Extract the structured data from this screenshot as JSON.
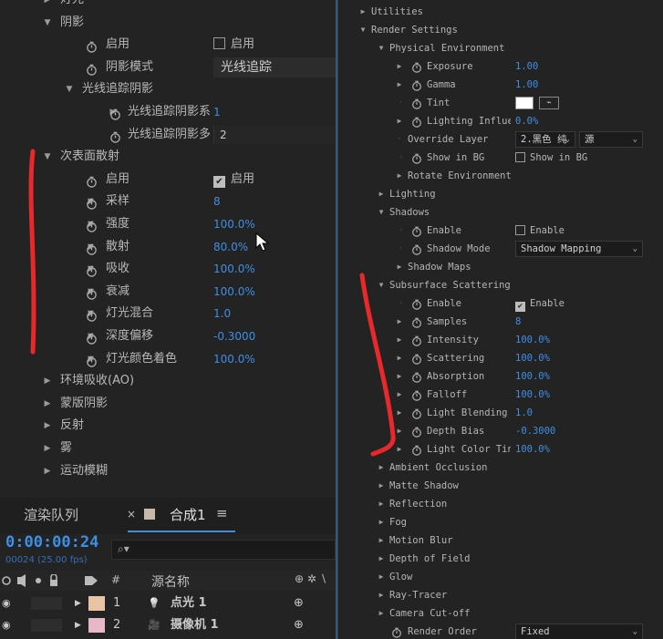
{
  "left_panel": {
    "rows": [
      {
        "id": "light",
        "label": "灯光",
        "arrow": "▶",
        "indent": 0
      },
      {
        "id": "shadow",
        "label": "阴影",
        "arrow": "▼",
        "indent": 0
      },
      {
        "id": "shadow-enable",
        "label": "启用",
        "indent": 2,
        "stopwatch": true,
        "checkbox": {
          "checked": false,
          "label": "启用"
        }
      },
      {
        "id": "shadow-mode",
        "label": "阴影模式",
        "indent": 2,
        "stopwatch": true,
        "dropdown": "光线追踪"
      },
      {
        "id": "rt-shadow",
        "label": "光线追踪阴影",
        "arrow": "▼",
        "indent": 1
      },
      {
        "id": "rt-shadow-1",
        "label": "光线追踪阴影系",
        "arrow": "▶",
        "indent": 3,
        "stopwatch": true,
        "value": "1"
      },
      {
        "id": "rt-shadow-2",
        "label": "光线追踪阴影多",
        "indent": 3,
        "stopwatch": true,
        "field": "2"
      },
      {
        "id": "sss",
        "label": "次表面散射",
        "arrow": "▼",
        "indent": 0
      },
      {
        "id": "sss-enable",
        "label": "启用",
        "indent": 2,
        "stopwatch": true,
        "checkbox": {
          "checked": true,
          "label": "启用"
        }
      },
      {
        "id": "sss-samples",
        "label": "采样",
        "arrow": "▶",
        "indent": 2,
        "stopwatch": true,
        "value": "8"
      },
      {
        "id": "sss-intensity",
        "label": "强度",
        "arrow": "▶",
        "indent": 2,
        "stopwatch": true,
        "value": "100.0%"
      },
      {
        "id": "sss-scatter",
        "label": "散射",
        "arrow": "▶",
        "indent": 2,
        "stopwatch": true,
        "value": "80.0%"
      },
      {
        "id": "sss-absorb",
        "label": "吸收",
        "arrow": "▶",
        "indent": 2,
        "stopwatch": true,
        "value": "100.0%"
      },
      {
        "id": "sss-falloff",
        "label": "衰减",
        "arrow": "▶",
        "indent": 2,
        "stopwatch": true,
        "value": "100.0%"
      },
      {
        "id": "sss-lightblend",
        "label": "灯光混合",
        "arrow": "▶",
        "indent": 2,
        "stopwatch": true,
        "value": "1.0"
      },
      {
        "id": "sss-depthbias",
        "label": "深度偏移",
        "arrow": "▶",
        "indent": 2,
        "stopwatch": true,
        "value": "-0.3000"
      },
      {
        "id": "sss-lighttint",
        "label": "灯光颜色着色",
        "arrow": "▶",
        "indent": 2,
        "stopwatch": true,
        "value": "100.0%"
      },
      {
        "id": "ao",
        "label": "环境吸收(AO)",
        "arrow": "▶",
        "indent": 0
      },
      {
        "id": "matte",
        "label": "蒙版阴影",
        "arrow": "▶",
        "indent": 0
      },
      {
        "id": "reflect",
        "label": "反射",
        "arrow": "▶",
        "indent": 0
      },
      {
        "id": "fog",
        "label": "雾",
        "arrow": "▶",
        "indent": 0
      },
      {
        "id": "motionblur",
        "label": "运动模糊",
        "arrow": "▶",
        "indent": 0
      }
    ]
  },
  "timeline": {
    "tab_render_queue": "渲染队列",
    "tab_close": "×",
    "tab_comp": "合成1",
    "tab_menu": "≡",
    "timecode": "0:00:00:24",
    "frames": "00024 (25.00 fps)",
    "search_icon": "⌕▾",
    "header_hash": "#",
    "header_source": "源名称",
    "layers": [
      {
        "num": "1",
        "color": "#e8c4a4",
        "icon": "💡",
        "name": "点光 1"
      },
      {
        "num": "2",
        "color": "#e8b8c8",
        "icon": "🎥",
        "name": "摄像机 1"
      }
    ]
  },
  "right_panel": {
    "rows": [
      {
        "id": "utilities",
        "label": "Utilities",
        "arrow": "▶",
        "indent": 0
      },
      {
        "id": "render-settings",
        "label": "Render Settings",
        "arrow": "▼",
        "indent": 0
      },
      {
        "id": "phys-env",
        "label": "Physical Environment",
        "arrow": "▼",
        "indent": 1
      },
      {
        "id": "exposure",
        "label": "Exposure",
        "arrow": "▶",
        "indent": 3,
        "stopwatch": true,
        "value": "1.00"
      },
      {
        "id": "gamma",
        "label": "Gamma",
        "arrow": "▶",
        "indent": 3,
        "stopwatch": true,
        "value": "1.00"
      },
      {
        "id": "tint",
        "label": "Tint",
        "indent": 3,
        "stopwatch": true,
        "swatch": "#ffffff"
      },
      {
        "id": "lighting-influence",
        "label": "Lighting Influer",
        "arrow": "▶",
        "indent": 3,
        "stopwatch": true,
        "value": "0.0%"
      },
      {
        "id": "override-layer",
        "label": "Override Layer",
        "indent": 2,
        "dot": true,
        "dropdown1": "2.黑色 纯",
        "dropdown2": "源"
      },
      {
        "id": "show-in-bg",
        "label": "Show in BG",
        "indent": 3,
        "stopwatch": true,
        "checkbox": {
          "checked": false,
          "label": "Show in BG"
        }
      },
      {
        "id": "rotate-env",
        "label": "Rotate Environment",
        "arrow": "▶",
        "indent": 2
      },
      {
        "id": "lighting",
        "label": "Lighting",
        "arrow": "▶",
        "indent": 1
      },
      {
        "id": "shadows",
        "label": "Shadows",
        "arrow": "▼",
        "indent": 1
      },
      {
        "id": "sh-enable",
        "label": "Enable",
        "indent": 3,
        "stopwatch": true,
        "checkbox": {
          "checked": false,
          "label": "Enable"
        }
      },
      {
        "id": "sh-mode",
        "label": "Shadow Mode",
        "indent": 3,
        "stopwatch": true,
        "dropdown": "Shadow Mapping"
      },
      {
        "id": "sh-maps",
        "label": "Shadow Maps",
        "arrow": "▶",
        "indent": 2
      },
      {
        "id": "subsurface",
        "label": "Subsurface Scattering",
        "arrow": "▼",
        "indent": 1
      },
      {
        "id": "ss-enable",
        "label": "Enable",
        "indent": 3,
        "stopwatch": true,
        "checkbox": {
          "checked": true,
          "label": "Enable"
        }
      },
      {
        "id": "ss-samples",
        "label": "Samples",
        "arrow": "▶",
        "indent": 3,
        "stopwatch": true,
        "value": "8"
      },
      {
        "id": "ss-intensity",
        "label": "Intensity",
        "arrow": "▶",
        "indent": 3,
        "stopwatch": true,
        "value": "100.0%"
      },
      {
        "id": "ss-scattering",
        "label": "Scattering",
        "arrow": "▶",
        "indent": 3,
        "stopwatch": true,
        "value": "100.0%"
      },
      {
        "id": "ss-absorption",
        "label": "Absorption",
        "arrow": "▶",
        "indent": 3,
        "stopwatch": true,
        "value": "100.0%"
      },
      {
        "id": "ss-falloff",
        "label": "Falloff",
        "arrow": "▶",
        "indent": 3,
        "stopwatch": true,
        "value": "100.0%"
      },
      {
        "id": "ss-lightblend",
        "label": "Light Blending",
        "arrow": "▶",
        "indent": 3,
        "stopwatch": true,
        "value": "1.0"
      },
      {
        "id": "ss-depthbias",
        "label": "Depth Bias",
        "arrow": "▶",
        "indent": 3,
        "stopwatch": true,
        "value": "-0.3000"
      },
      {
        "id": "ss-lighttint",
        "label": "Light Color Tin",
        "arrow": "▶",
        "indent": 3,
        "stopwatch": true,
        "value": "100.0%"
      },
      {
        "id": "ambient-occ",
        "label": "Ambient Occlusion",
        "arrow": "▶",
        "indent": 1
      },
      {
        "id": "matte-shadow",
        "label": "Matte Shadow",
        "arrow": "▶",
        "indent": 1
      },
      {
        "id": "reflection",
        "label": "Reflection",
        "arrow": "▶",
        "indent": 1
      },
      {
        "id": "fog",
        "label": "Fog",
        "arrow": "▶",
        "indent": 1
      },
      {
        "id": "motion-blur",
        "label": "Motion Blur",
        "arrow": "▶",
        "indent": 1
      },
      {
        "id": "dof",
        "label": "Depth of Field",
        "arrow": "▶",
        "indent": 1
      },
      {
        "id": "glow",
        "label": "Glow",
        "arrow": "▶",
        "indent": 1
      },
      {
        "id": "ray-tracer",
        "label": "Ray-Tracer",
        "arrow": "▶",
        "indent": 1
      },
      {
        "id": "camera-cutoff",
        "label": "Camera Cut-off",
        "arrow": "▶",
        "indent": 1
      },
      {
        "id": "render-order",
        "label": "Render Order",
        "indent": 2,
        "stopwatch": true,
        "dropdown": "Fixed"
      }
    ]
  },
  "colors": {
    "value_blue": "#3f8ee6",
    "annotation_red": "#e8282a",
    "panel_bg": "#232323"
  }
}
